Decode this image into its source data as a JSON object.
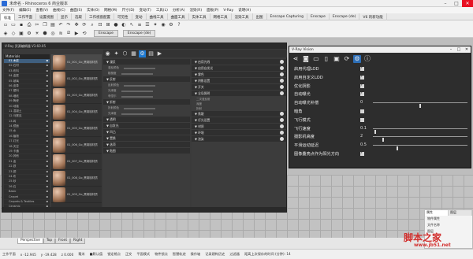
{
  "window": {
    "title": "未命名 - Rhinoceros 6 商业版本"
  },
  "menu": [
    "文件(F)",
    "编辑(E)",
    "查看(V)",
    "曲线(C)",
    "曲面(S)",
    "实体(O)",
    "网格(M)",
    "尺寸(D)",
    "变动(T)",
    "工具(L)",
    "分析(A)",
    "渲染(R)",
    "面板(P)",
    "V-Ray",
    "说明(H)"
  ],
  "ribbon_tabs": [
    "标准",
    "工作平面",
    "设置视图",
    "显示",
    "选取",
    "工作视窗配置",
    "可见性",
    "变动",
    "曲线工具",
    "曲面工具",
    "实体工具",
    "网格工具",
    "渲染工具",
    "出图",
    "Enscape Capturing",
    "Enscape",
    "Enscape (de)",
    "V6 的新功能"
  ],
  "chips": [
    "Enscape",
    "Enscape (de)"
  ],
  "vray_editor": {
    "title": "V-Ray 资源编辑器 V3.60.05",
    "tree_header": "Materials",
    "tree_items": [
      "01.木纹",
      "02.石材",
      "03.布料",
      "04.金属",
      "05.玻璃",
      "06.皮革",
      "07.塑料",
      "08.墙纸",
      "09.陶瓷",
      "10.地毯",
      "11.混凝土",
      "12.马赛克",
      "13.砖",
      "14.镜面",
      "15.水",
      "16.植物",
      "17.灯光",
      "18.天空",
      "19.卡通",
      "20.其他",
      "21.金",
      "22.铁",
      "23.铜",
      "24.布",
      "25.砂",
      "26.石",
      "Basic",
      "Carpet",
      "Carpets & Textiles",
      "Ceramic"
    ],
    "materials": [
      "01_001_Go_黑胡桃材质",
      "01_002_Go_黑胡桃材质",
      "01_003_Go_黑胡桃材质",
      "01_004_Go_黑胡桃材质",
      "01_005_Go_黑胡桃材质",
      "01_006_Go_黑胡桃材质",
      "01_007_Go_黑胡桃材质",
      "01_008_Go_黑胡桃材质",
      "01_009_Go_黑胡桃材质"
    ],
    "props_left": [
      {
        "type": "sec",
        "label": "▼ 漫反"
      },
      {
        "type": "row",
        "label": "漫反颜色"
      },
      {
        "type": "row",
        "label": "粗糙度"
      },
      {
        "type": "sec",
        "label": "▼ 反射"
      },
      {
        "type": "row",
        "label": "反射颜色"
      },
      {
        "type": "row",
        "label": "光泽度"
      },
      {
        "type": "row",
        "label": "菲涅尔"
      },
      {
        "type": "sec",
        "label": "▼ 折射"
      },
      {
        "type": "row",
        "label": "折射颜色"
      },
      {
        "type": "row",
        "label": "光泽度"
      },
      {
        "type": "sec",
        "label": "▼ 透明"
      },
      {
        "type": "sec",
        "label": "▼ 自发光"
      },
      {
        "type": "sec",
        "label": "▼ 凹凸"
      },
      {
        "type": "sec",
        "label": "▼ 置换"
      },
      {
        "type": "sec",
        "label": "▼ 选项"
      },
      {
        "type": "sec",
        "label": "▼ 贴图"
      }
    ],
    "props_right": [
      {
        "type": "sec",
        "label": "▼ 启用光线"
      },
      {
        "type": "sec",
        "label": "▼ 启用自发光"
      },
      {
        "type": "sec",
        "label": "▼ 雾色"
      },
      {
        "type": "sec",
        "label": "▼ 阴影设置"
      },
      {
        "type": "sec",
        "label": "▼ 开关"
      },
      {
        "type": "sec",
        "label": "▼ 全局照明"
      },
      {
        "type": "row",
        "label": "二次漫反射"
      },
      {
        "type": "row",
        "label": "深度"
      },
      {
        "type": "row",
        "label": "折射"
      },
      {
        "type": "sec",
        "label": "▼ 焦散"
      },
      {
        "type": "sec",
        "label": "▼ 灯光设置"
      },
      {
        "type": "sec",
        "label": "▼ 材质"
      },
      {
        "type": "sec",
        "label": "▼ 环境"
      },
      {
        "type": "sec",
        "label": "▼ 渲染"
      }
    ]
  },
  "vision": {
    "title": "V-Ray Vision",
    "rows": [
      {
        "label": "启用代理LOD",
        "control": "checkbox",
        "checked": true
      },
      {
        "label": "启用自定义LOD",
        "control": "checkbox",
        "checked": true
      },
      {
        "label": "优化阴影",
        "control": "checkbox",
        "checked": true
      },
      {
        "label": "自动曝光",
        "control": "checkbox",
        "checked": true
      },
      {
        "label": "自动曝光补偿",
        "control": "slider",
        "value": "0",
        "position": 0.5
      },
      {
        "label": "暗角",
        "control": "checkbox",
        "checked": false
      },
      {
        "label": "飞行模式",
        "control": "checkbox",
        "checked": false
      },
      {
        "label": "飞行速度",
        "control": "slider",
        "value": "0.1",
        "position": 0.02
      },
      {
        "label": "摄影机高度",
        "control": "slider",
        "value": "2",
        "position": 0.1
      },
      {
        "label": "平滑运动延迟",
        "control": "slider",
        "value": "0.5",
        "position": 0.25
      },
      {
        "label": "图像叠亮点作为阳光方向",
        "control": "checkbox",
        "checked": true
      }
    ]
  },
  "viewport_tabs": [
    "Perspective",
    "Top",
    "Front",
    "Right"
  ],
  "properties_panel": {
    "tabs": [
      "属性",
      "图层"
    ],
    "rows": [
      "物件属性",
      "文件名称",
      "图层"
    ]
  },
  "statusbar": [
    "工作平面",
    "x -12.945",
    "y -19.428",
    "z 0.000",
    "毫米",
    "■默认值",
    "锁定格点",
    "正交",
    "平面模式",
    "物件锁点",
    "智慧轨迹",
    "操作轴",
    "记录建构历史",
    "过滤器",
    "距离上次保存的时间 (分钟): 14"
  ],
  "watermark": {
    "line1": "脚本之家",
    "line2": "www.jb51.net"
  }
}
